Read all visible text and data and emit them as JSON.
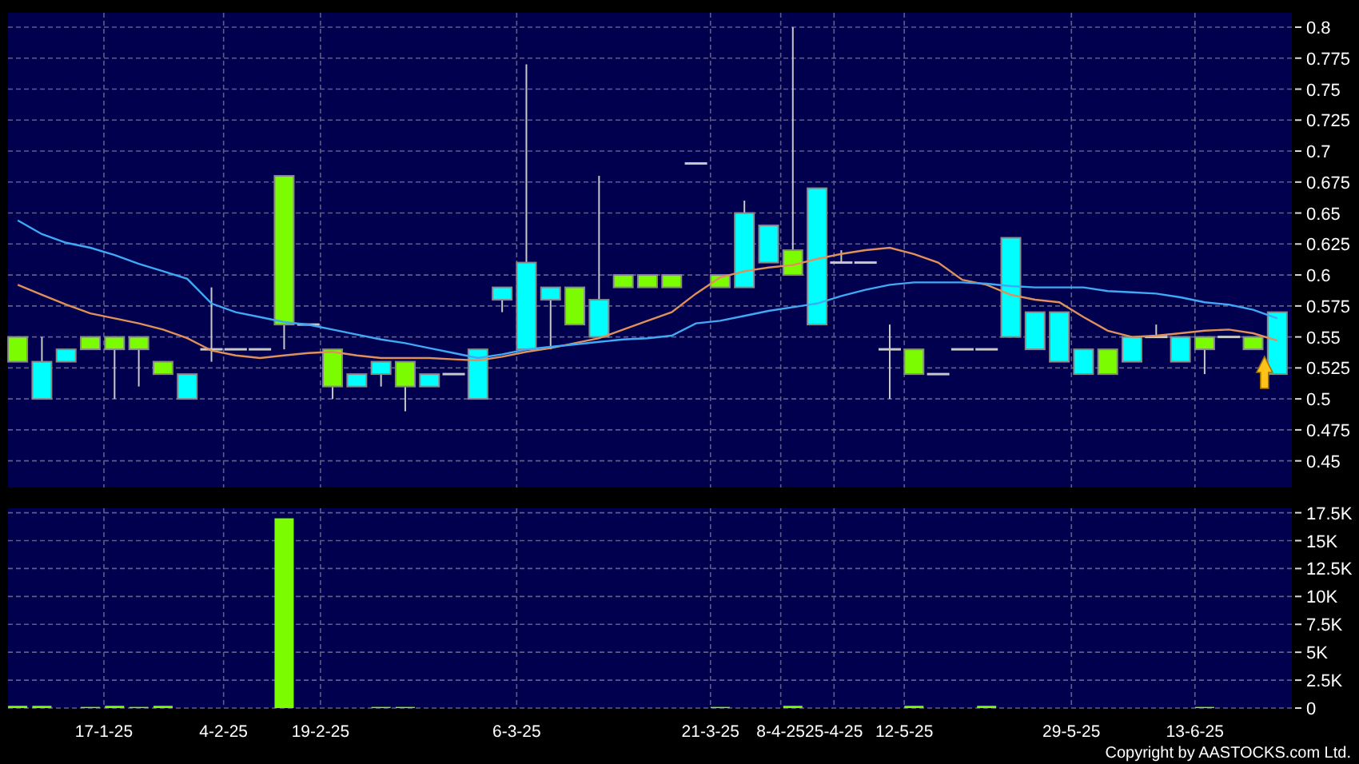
{
  "price_panel": {
    "chart_data": {
      "type": "line",
      "grid": true,
      "ylim": [
        0.4285,
        0.8116
      ],
      "yticks": [
        0.45,
        0.475,
        0.5,
        0.525,
        0.55,
        0.575,
        0.6,
        0.625,
        0.65,
        0.675,
        0.7,
        0.725,
        0.75,
        0.775,
        0.8
      ],
      "series": [
        {
          "color": "#e0905a",
          "values": [
            0.592,
            0.584,
            0.576,
            0.569,
            0.565,
            0.561,
            0.556,
            0.549,
            0.539,
            0.535,
            0.533,
            0.535,
            0.537,
            0.538,
            0.535,
            0.533,
            0.533,
            0.533,
            0.532,
            0.531,
            0.534,
            0.538,
            0.541,
            0.545,
            0.549,
            0.556,
            0.563,
            0.57,
            0.585,
            0.598,
            0.603,
            0.606,
            0.608,
            0.613,
            0.617,
            0.62,
            0.622,
            0.617,
            0.61,
            0.596,
            0.592,
            0.584,
            0.58,
            0.578,
            0.566,
            0.555,
            0.55,
            0.551,
            0.553,
            0.555,
            0.556,
            0.553,
            0.547
          ]
        },
        {
          "color": "#3fa9f5",
          "values": [
            0.644,
            0.633,
            0.626,
            0.622,
            0.616,
            0.609,
            0.603,
            0.597,
            0.577,
            0.57,
            0.566,
            0.562,
            0.56,
            0.556,
            0.552,
            0.548,
            0.545,
            0.541,
            0.537,
            0.533,
            0.536,
            0.54,
            0.542,
            0.544,
            0.546,
            0.548,
            0.549,
            0.551,
            0.561,
            0.563,
            0.567,
            0.571,
            0.574,
            0.577,
            0.583,
            0.588,
            0.592,
            0.594,
            0.594,
            0.594,
            0.593,
            0.591,
            0.59,
            0.59,
            0.59,
            0.587,
            0.586,
            0.585,
            0.582,
            0.578,
            0.576,
            0.572,
            0.565
          ]
        }
      ]
    },
    "candles": [
      {
        "color": "#7cfc00"
      },
      {
        "color": "#00ffff"
      },
      {
        "color": "#00ffff"
      },
      {
        "color": "#7cfc00"
      },
      {
        "color": "#7cfc00"
      },
      {
        "color": "#7cfc00"
      },
      {
        "color": "#7cfc00"
      },
      {
        "color": "#00ffff"
      },
      {
        "color": "#c8c8c8"
      },
      {
        "color": "#c8c8c8"
      },
      {
        "color": "#c8c8c8"
      },
      {
        "color": "#7cfc00"
      },
      {
        "color": "#c8c8c8"
      },
      {
        "color": "#7cfc00"
      },
      {
        "color": "#00ffff"
      },
      {
        "color": "#00ffff"
      },
      {
        "color": "#7cfc00"
      },
      {
        "color": "#00ffff"
      },
      {
        "color": "#c8c8c8"
      },
      {
        "color": "#00ffff"
      },
      {
        "color": "#00ffff"
      },
      {
        "color": "#00ffff"
      },
      {
        "color": "#00ffff"
      },
      {
        "color": "#7cfc00"
      },
      {
        "color": "#00ffff"
      },
      {
        "color": "#7cfc00"
      },
      {
        "color": "#7cfc00"
      },
      {
        "color": "#7cfc00"
      },
      {
        "color": "#c8c8c8"
      },
      {
        "color": "#7cfc00"
      },
      {
        "color": "#00ffff"
      },
      {
        "color": "#00ffff"
      },
      {
        "color": "#7cfc00"
      },
      {
        "color": "#00ffff"
      },
      {
        "color": "#c8c8c8"
      },
      {
        "color": "#c8c8c8"
      },
      {
        "color": "#c8c8c8"
      },
      {
        "color": "#7cfc00"
      },
      {
        "color": "#c8c8c8"
      },
      {
        "color": "#c8c8c8"
      },
      {
        "color": "#c8c8c8"
      },
      {
        "color": "#00ffff"
      },
      {
        "color": "#00ffff"
      },
      {
        "color": "#00ffff"
      },
      {
        "color": "#00ffff"
      },
      {
        "color": "#7cfc00"
      },
      {
        "color": "#00ffff"
      },
      {
        "color": "#c8c8c8"
      },
      {
        "color": "#00ffff"
      },
      {
        "color": "#7cfc00"
      },
      {
        "color": "#c8c8c8"
      },
      {
        "color": "#7cfc00"
      },
      {
        "color": "#00ffff"
      }
    ]
  },
  "volume_panel": {
    "chart_data": {
      "type": "bar",
      "grid": true,
      "ylim": [
        0,
        17900
      ],
      "yticks": [
        0,
        {
          "value": 2500,
          "label": "2.5K"
        },
        {
          "value": 5000,
          "label": "5K"
        },
        {
          "value": 7500,
          "label": "7.5K"
        },
        {
          "value": 10000,
          "label": "10K"
        },
        {
          "value": 12500,
          "label": "12.5K"
        },
        {
          "value": 15000,
          "label": "15K"
        },
        {
          "value": 17500,
          "label": "17.5K"
        }
      ],
      "series": [
        {
          "color": "#7cfc00",
          "values": [
            200,
            200,
            0,
            100,
            200,
            100,
            200,
            0,
            0,
            0,
            0,
            17000,
            0,
            0,
            0,
            100,
            100,
            0,
            0,
            0,
            0,
            0,
            0,
            0,
            0,
            0,
            0,
            0,
            0,
            100,
            0,
            0,
            200,
            0,
            0,
            0,
            0,
            200,
            0,
            0,
            200,
            0,
            0,
            0,
            0,
            0,
            0,
            0,
            0,
            100,
            0,
            0,
            0
          ]
        }
      ]
    },
    "date_labels": [
      "17-1-25",
      "4-2-25",
      "19-2-25",
      "6-3-25",
      "21-3-25",
      "8-4-25",
      "25-4-25",
      "12-5-25",
      "29-5-25",
      "13-6-25"
    ]
  },
  "copyright": "Copyright by AASTOCKS.com Ltd."
}
